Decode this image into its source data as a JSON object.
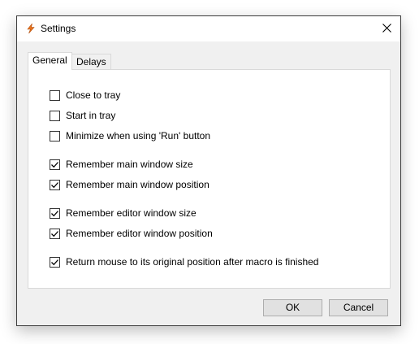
{
  "window": {
    "title": "Settings",
    "app_icon": "lightning-bolt-icon",
    "close_icon": "close-icon"
  },
  "tabs": [
    {
      "label": "General",
      "active": true
    },
    {
      "label": "Delays",
      "active": false
    }
  ],
  "options": [
    {
      "label": "Close to tray",
      "checked": false
    },
    {
      "label": "Start in tray",
      "checked": false
    },
    {
      "label": "Minimize when using 'Run' button",
      "checked": false
    },
    {
      "label": "Remember main window size",
      "checked": true
    },
    {
      "label": "Remember main window position",
      "checked": true
    },
    {
      "label": "Remember editor window size",
      "checked": true
    },
    {
      "label": "Remember editor window position",
      "checked": true
    },
    {
      "label": "Return mouse to its original position after macro is finished",
      "checked": true
    }
  ],
  "buttons": {
    "ok_label": "OK",
    "cancel_label": "Cancel"
  },
  "colors": {
    "icon_accent": "#e8721c",
    "titlebar": "#ffffff",
    "dialog_bg": "#f0f0f0"
  }
}
